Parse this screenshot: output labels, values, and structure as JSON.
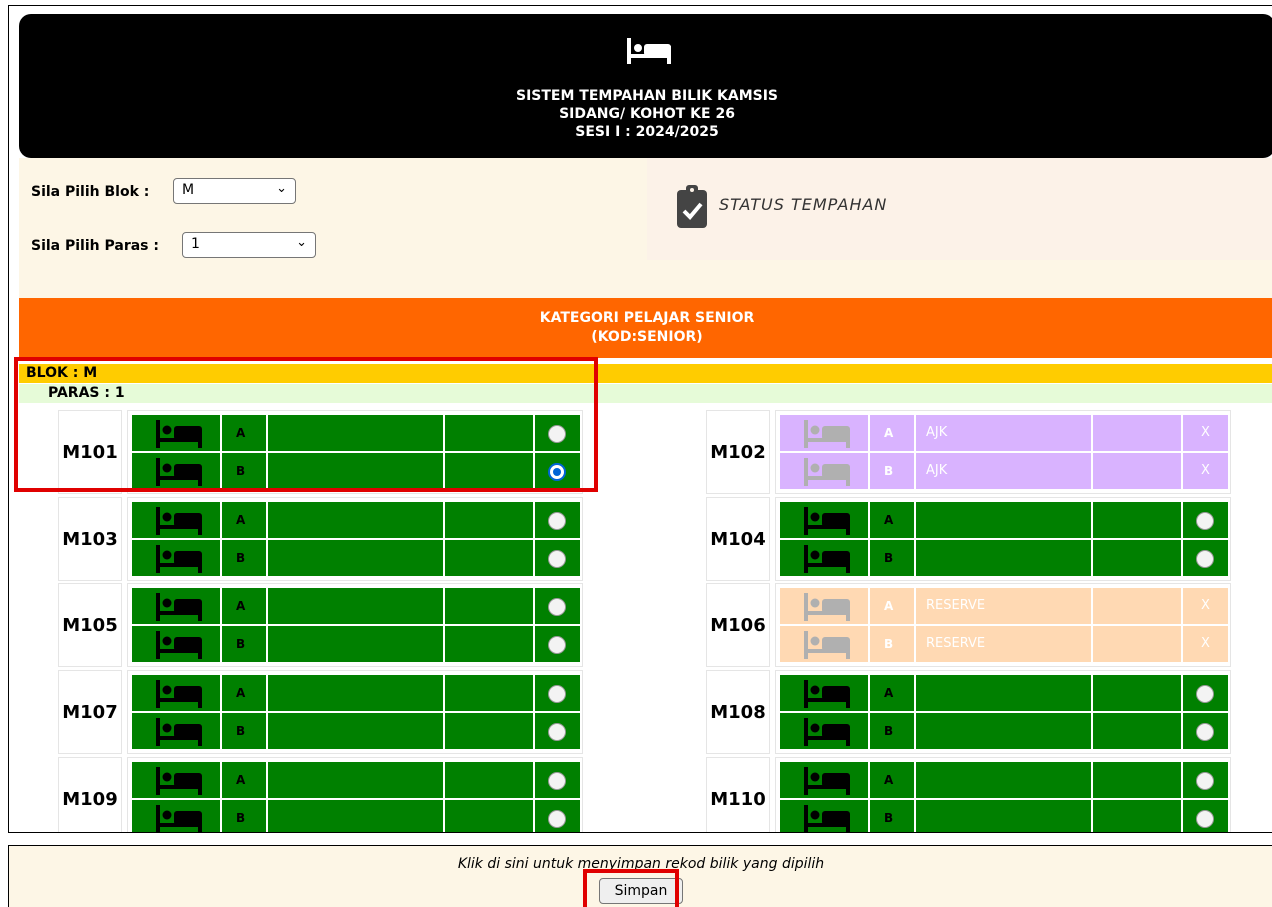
{
  "header": {
    "line1": "SISTEM TEMPAHAN BILIK KAMSIS",
    "line2": "SIDANG/ KOHOT KE 26",
    "line3": "SESI I : 2024/2025",
    "icon": "bed-icon"
  },
  "controls": {
    "blok_label": "Sila Pilih Blok :",
    "blok_value": "M",
    "paras_label": "Sila Pilih Paras :",
    "paras_value": "1"
  },
  "status": {
    "label": "STATUS TEMPAHAN",
    "icon": "clipboard-check-icon"
  },
  "kategori": {
    "line1": "KATEGORI PELAJAR SENIOR",
    "line2": "(KOD:SENIOR)"
  },
  "blok": "BLOK : M",
  "paras": "PARAS : 1",
  "colors": {
    "available": "#008000",
    "ajk": "#d9b3ff",
    "reserve": "#ffd9b3",
    "kategori": "#ff6600",
    "blok_bar": "#ffcc00"
  },
  "rooms": [
    {
      "code": "M101",
      "status": "available",
      "beds": [
        {
          "letter": "A",
          "name": "",
          "selected": false
        },
        {
          "letter": "B",
          "name": "",
          "selected": true
        }
      ]
    },
    {
      "code": "M102",
      "status": "ajk",
      "beds": [
        {
          "letter": "A",
          "name": "AJK",
          "mark": "X"
        },
        {
          "letter": "B",
          "name": "AJK",
          "mark": "X"
        }
      ]
    },
    {
      "code": "M103",
      "status": "available",
      "beds": [
        {
          "letter": "A",
          "name": "",
          "selected": false
        },
        {
          "letter": "B",
          "name": "",
          "selected": false
        }
      ]
    },
    {
      "code": "M104",
      "status": "available",
      "beds": [
        {
          "letter": "A",
          "name": "",
          "selected": false
        },
        {
          "letter": "B",
          "name": "",
          "selected": false
        }
      ]
    },
    {
      "code": "M105",
      "status": "available",
      "beds": [
        {
          "letter": "A",
          "name": "",
          "selected": false
        },
        {
          "letter": "B",
          "name": "",
          "selected": false
        }
      ]
    },
    {
      "code": "M106",
      "status": "reserve",
      "beds": [
        {
          "letter": "A",
          "name": "RESERVE",
          "mark": "X"
        },
        {
          "letter": "B",
          "name": "RESERVE",
          "mark": "X"
        }
      ]
    },
    {
      "code": "M107",
      "status": "available",
      "beds": [
        {
          "letter": "A",
          "name": "",
          "selected": false
        },
        {
          "letter": "B",
          "name": "",
          "selected": false
        }
      ]
    },
    {
      "code": "M108",
      "status": "available",
      "beds": [
        {
          "letter": "A",
          "name": "",
          "selected": false
        },
        {
          "letter": "B",
          "name": "",
          "selected": false
        }
      ]
    },
    {
      "code": "M109",
      "status": "available",
      "beds": [
        {
          "letter": "A",
          "name": "",
          "selected": false
        },
        {
          "letter": "B",
          "name": "",
          "selected": false
        }
      ]
    },
    {
      "code": "M110",
      "status": "available",
      "beds": [
        {
          "letter": "A",
          "name": "",
          "selected": false
        },
        {
          "letter": "B",
          "name": "",
          "selected": false
        }
      ]
    }
  ],
  "footer": {
    "note": "Klik di sini untuk menyimpan rekod bilik yang dipilih",
    "button": "Simpan"
  }
}
